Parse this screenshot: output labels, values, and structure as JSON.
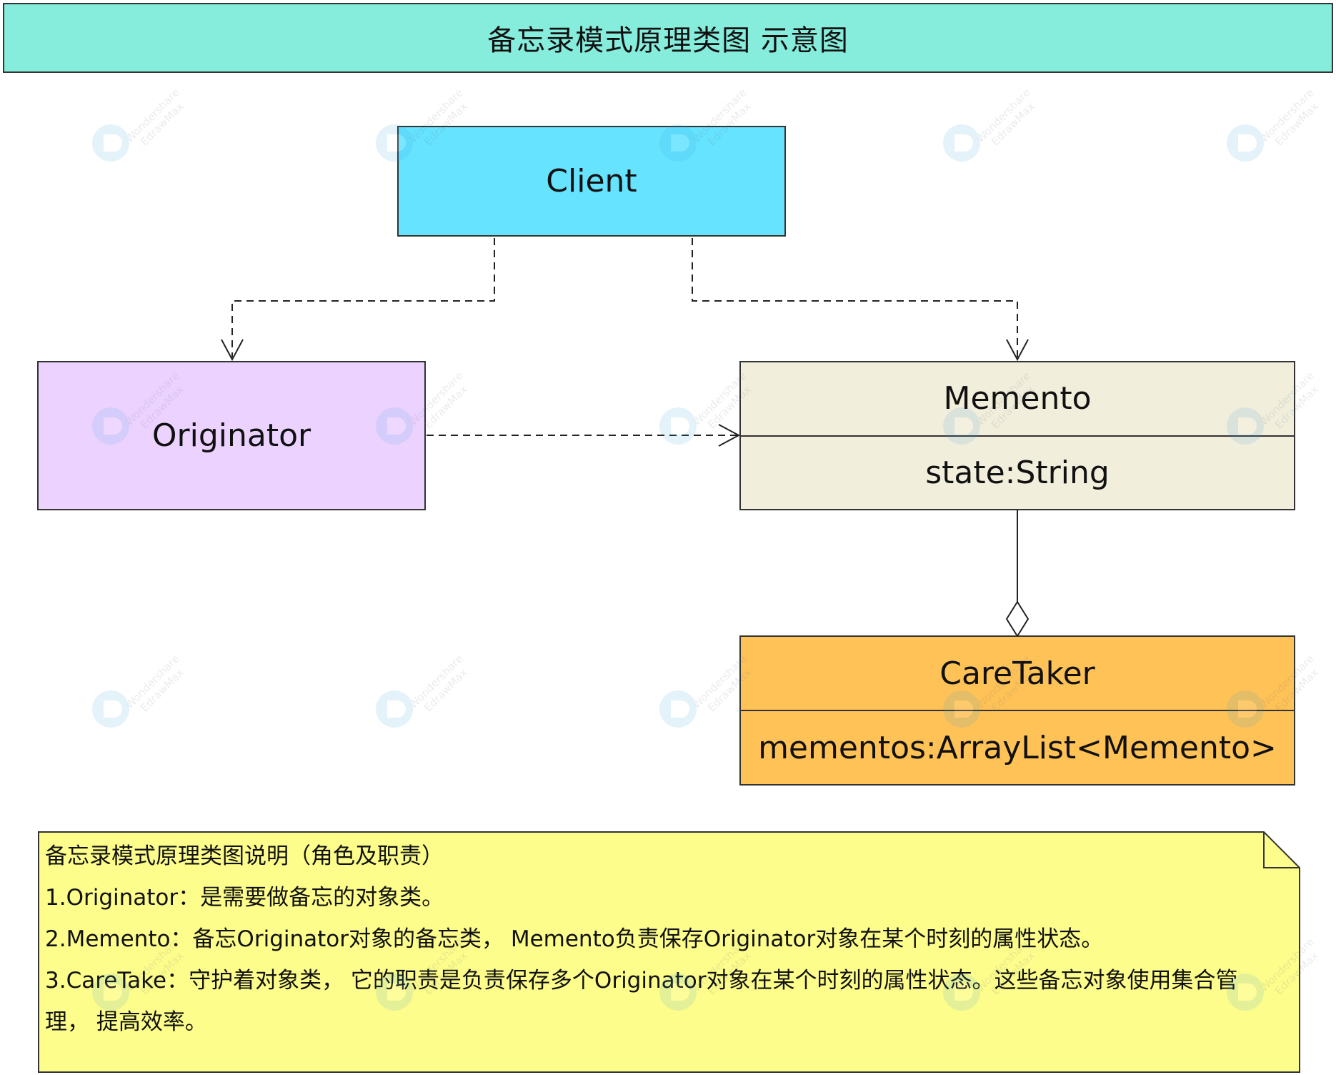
{
  "title": "备忘录模式原理类图 示意图",
  "colors": {
    "banner": "#86ecdc",
    "client": "#66e3ff",
    "originator": "#ecd3ff",
    "memento": "#f2eedc",
    "caretaker": "#ffc257",
    "note": "#fdfd8c"
  },
  "classes": {
    "client": {
      "name": "Client"
    },
    "originator": {
      "name": "Originator"
    },
    "memento": {
      "name": "Memento",
      "attribute": "state:String"
    },
    "caretaker": {
      "name": "CareTaker",
      "attribute": "mementos:ArrayList<Memento>"
    }
  },
  "note": {
    "heading": "备忘录模式原理类图说明（角色及职责）",
    "items": [
      "1.Originator：是需要做备忘的对象类。",
      "2.Memento：备忘Originator对象的备忘类，  Memento负责保存Originator对象在某个时刻的属性状态。",
      "3.CareTake：守护着对象类，  它的职责是负责保存多个Originator对象在某个时刻的属性状态。这些备忘对象使用集合管理，  提高效率。"
    ]
  },
  "watermark": {
    "line1": "Wondershare",
    "line2": "EdrawMax"
  }
}
